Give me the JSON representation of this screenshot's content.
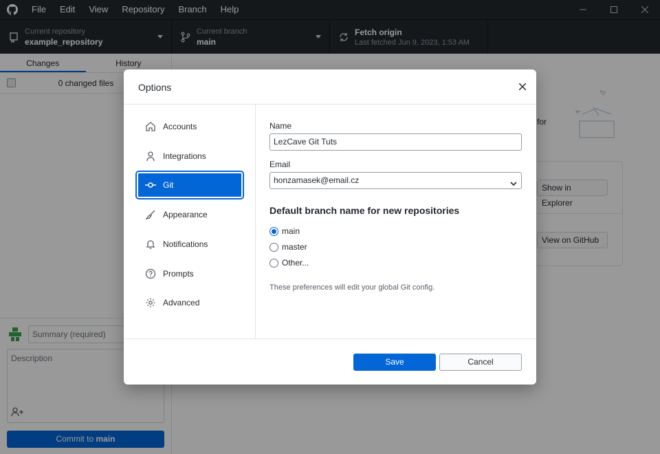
{
  "window": {
    "menu": [
      "File",
      "Edit",
      "View",
      "Repository",
      "Branch",
      "Help"
    ],
    "controls": [
      "minimize-icon",
      "maximize-icon",
      "close-icon"
    ]
  },
  "toolbar": {
    "repo_label": "Current repository",
    "repo_value": "example_repository",
    "branch_label": "Current branch",
    "branch_value": "main",
    "fetch_label": "Fetch origin",
    "fetch_value": "Last fetched Jun 9, 2023, 1:53 AM"
  },
  "sidebar": {
    "tabs": [
      "Changes",
      "History"
    ],
    "changed_files": "0 changed files",
    "summary_placeholder": "Summary (required)",
    "description_placeholder": "Description",
    "commit_prefix": "Commit to ",
    "commit_branch": "main"
  },
  "background": {
    "for_text": "for",
    "show_in_explorer": "Show in Explorer",
    "view_on_github": "View on GitHub"
  },
  "dialog": {
    "title": "Options",
    "nav": [
      {
        "label": "Accounts",
        "icon": "home-icon"
      },
      {
        "label": "Integrations",
        "icon": "person-icon"
      },
      {
        "label": "Git",
        "icon": "git-commit-icon"
      },
      {
        "label": "Appearance",
        "icon": "paintbrush-icon"
      },
      {
        "label": "Notifications",
        "icon": "bell-icon"
      },
      {
        "label": "Prompts",
        "icon": "question-icon"
      },
      {
        "label": "Advanced",
        "icon": "gear-icon"
      }
    ],
    "selected_nav": "Git",
    "name_label": "Name",
    "name_value": "LezCave Git Tuts",
    "email_label": "Email",
    "email_value": "honzamasek@email.cz",
    "branch_section": "Default branch name for new repositories",
    "branch_options": [
      "main",
      "master",
      "Other..."
    ],
    "branch_selected": "main",
    "note": "These preferences will edit your global Git config.",
    "save_label": "Save",
    "cancel_label": "Cancel"
  },
  "colors": {
    "accent": "#0366d6",
    "titlebar": "#24292e"
  }
}
